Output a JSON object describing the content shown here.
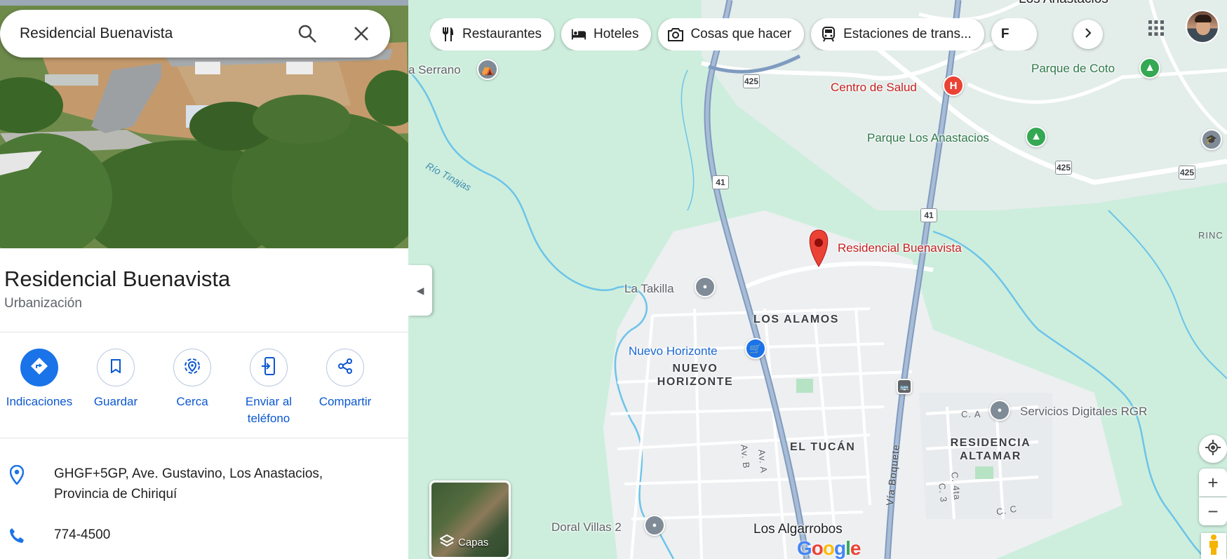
{
  "search": {
    "value": "Residencial Buenavista"
  },
  "place": {
    "name": "Residencial Buenavista",
    "category": "Urbanización",
    "actions": [
      {
        "label": "Indicaciones",
        "icon": "directions-icon"
      },
      {
        "label": "Guardar",
        "icon": "bookmark-icon"
      },
      {
        "label": "Cerca",
        "icon": "nearby-icon"
      },
      {
        "label": "Enviar al teléfono",
        "icon": "send-to-phone-icon"
      },
      {
        "label": "Compartir",
        "icon": "share-icon"
      }
    ],
    "address": "GHGF+5GP, Ave. Gustavino, Los Anastacios, Provincia de Chiriquí",
    "phone": "774-4500"
  },
  "chips": [
    {
      "label": "Restaurantes",
      "icon": "restaurant-icon"
    },
    {
      "label": "Hoteles",
      "icon": "hotel-icon"
    },
    {
      "label": "Cosas que hacer",
      "icon": "camera-icon"
    },
    {
      "label": "Estaciones de trans...",
      "icon": "transit-icon"
    },
    {
      "label": "F",
      "icon": "more-chip-icon"
    }
  ],
  "map": {
    "labels": {
      "top_right": "Los Anastacios",
      "serrano": "a Serrano",
      "centro_salud": "Centro de Salud",
      "parque_coto": "Parque de Coto",
      "parque_anastacios": "Parque Los Anastacios",
      "rio": "Río Tinajas",
      "buenavista": "Residencial Buenavista",
      "rinc": "RINC",
      "takilla": "La Takilla",
      "los_alamos": "LOS ALAMOS",
      "nuevo_horizonte_poi": "Nuevo Horizonte",
      "nuevo_horizonte_district": "NUEVO HORIZONTE",
      "el_tucan": "EL TUCÁN",
      "servicios": "Servicios Digitales RGR",
      "residencia_altamar": "RESIDENCIA ALTAMAR",
      "via_boquete": "Vía Boquete",
      "av_a": "Av. A",
      "av_b": "Av. B",
      "c_a": "C. A",
      "c_4ta": "C. 4ta",
      "c_3": "C. 3",
      "c_c": "C. C",
      "doral": "Doral Villas 2",
      "algarrobos": "Los Algarrobos"
    },
    "shields": [
      "425",
      "41",
      "41",
      "425",
      "425"
    ],
    "layers_label": "Capas",
    "google_logo": "Google"
  },
  "colors": {
    "map_bg": "#cdeedd",
    "road_urban": "#f1f3f4",
    "highway": "#8aa4c4",
    "river": "#6cc4e8",
    "accent": "#1a73e8",
    "pin": "#ea4335"
  }
}
